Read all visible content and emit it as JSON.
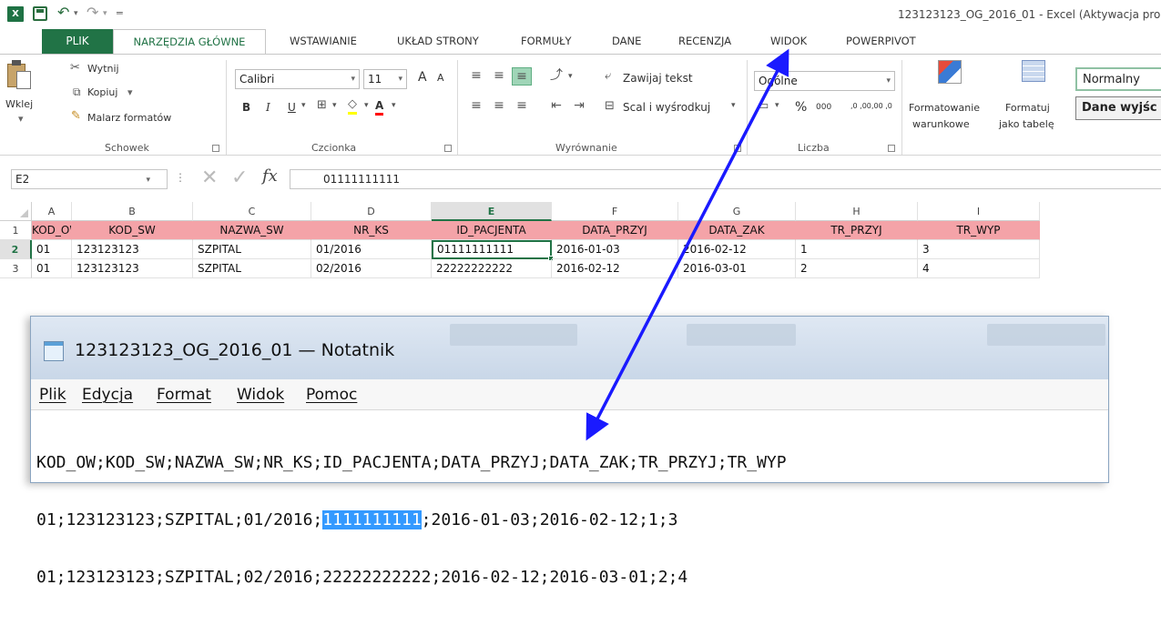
{
  "window": {
    "title": "123123123_OG_2016_01 - Excel (Aktywacja pro",
    "app_icon_letter": "X"
  },
  "ribbon_tabs": [
    "PLIK",
    "NARZĘDZIA GŁÓWNE",
    "WSTAWIANIE",
    "UKŁAD STRONY",
    "FORMUŁY",
    "DANE",
    "RECENZJA",
    "WIDOK",
    "POWERPIVOT"
  ],
  "ribbon": {
    "clipboard": {
      "label": "Schowek",
      "paste": "Wklej",
      "cut": "Wytnij",
      "copy": "Kopiuj",
      "format_painter": "Malarz formatów"
    },
    "font": {
      "label": "Czcionka",
      "font_name": "Calibri",
      "font_size": "11",
      "grow": "A",
      "shrink": "A",
      "bold": "B",
      "italic": "I",
      "underline": "U"
    },
    "alignment": {
      "label": "Wyrównanie",
      "wrap_text": "Zawijaj tekst",
      "merge_center": "Scal i wyśrodkuj"
    },
    "number": {
      "label": "Liczba",
      "format": "Ogólne",
      "percent": "%",
      "thousands": "000",
      "inc_decimal": ",0 ,00",
      "dec_decimal": ",00 ,0"
    },
    "styles": {
      "conditional_1": "Formatowanie",
      "conditional_2": "warunkowe",
      "table_1": "Formatuj",
      "table_2": "jako tabelę",
      "normal": "Normalny",
      "output": "Dane wyjśc"
    }
  },
  "formula_bar": {
    "name_box": "E2",
    "fx": "fx",
    "value": "01111111111"
  },
  "sheet": {
    "columns": [
      "A",
      "B",
      "C",
      "D",
      "E",
      "F",
      "G",
      "H",
      "I"
    ],
    "rows": [
      "1",
      "2",
      "3"
    ],
    "data": [
      [
        "KOD_OW",
        "KOD_SW",
        "NAZWA_SW",
        "NR_KS",
        "ID_PACJENTA",
        "DATA_PRZYJ",
        "DATA_ZAK",
        "TR_PRZYJ",
        "TR_WYP"
      ],
      [
        "01",
        "123123123",
        "SZPITAL",
        "01/2016",
        "01111111111",
        "2016-01-03",
        "2016-02-12",
        "1",
        "3"
      ],
      [
        "01",
        "123123123",
        "SZPITAL",
        "02/2016",
        "22222222222",
        "2016-02-12",
        "2016-03-01",
        "2",
        "4"
      ]
    ],
    "active_cell": "E2",
    "header_fill": "#f4a3a8"
  },
  "notepad": {
    "title": "123123123_OG_2016_01 — Notatnik",
    "menu": [
      "Plik",
      "Edycja",
      "Format",
      "Widok",
      "Pomoc"
    ],
    "line1": "KOD_OW;KOD_SW;NAZWA_SW;NR_KS;ID_PACJENTA;DATA_PRZYJ;DATA_ZAK;TR_PRZYJ;TR_WYP",
    "line2_pre": "01;123123123;SZPITAL;01/2016;",
    "line2_sel": "1111111111",
    "line2_post": ";2016-01-03;2016-02-12;1;3",
    "line3": "01;123123123;SZPITAL;02/2016;22222222222;2016-02-12;2016-03-01;2;4"
  },
  "annotation": {
    "arrow_color": "#1a1aff"
  }
}
